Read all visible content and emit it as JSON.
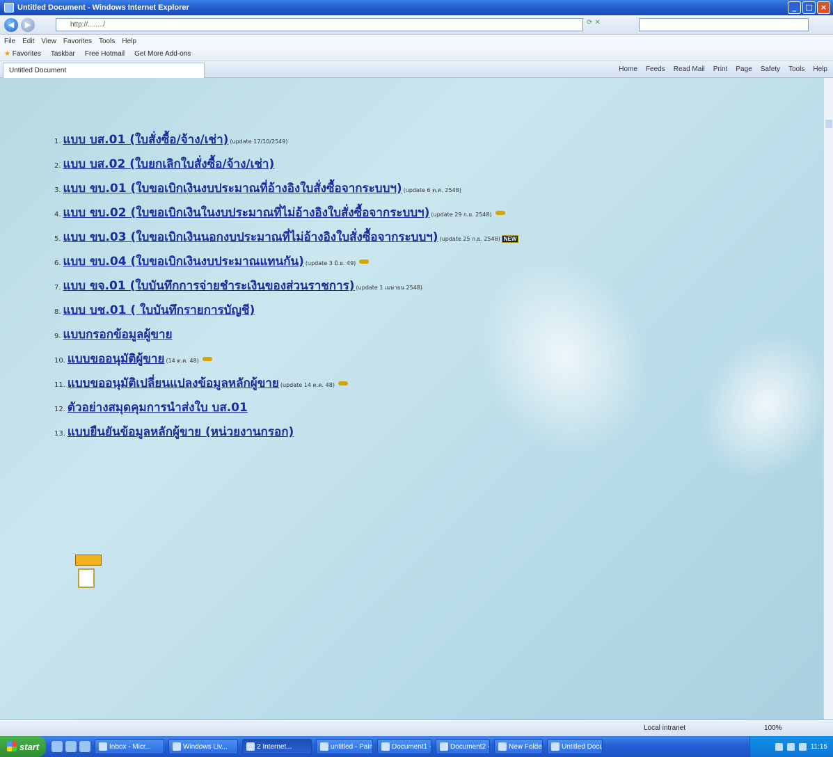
{
  "window": {
    "title": "Untitled Document - Windows Internet Explorer"
  },
  "address": {
    "url": "http://......../"
  },
  "search": {
    "placeholder": ""
  },
  "menu": [
    "File",
    "Edit",
    "View",
    "Favorites",
    "Tools",
    "Help"
  ],
  "favorites": {
    "label": "Favorites",
    "items": [
      "Taskbar",
      "Free Hotmail",
      "Get More Add-ons"
    ]
  },
  "tab": {
    "label": "Untitled Document"
  },
  "command_bar": [
    "Home",
    "Feeds",
    "Read Mail",
    "Print",
    "Page",
    "Safety",
    "Tools",
    "Help"
  ],
  "links": [
    {
      "num": "1.",
      "text": "แบบ บส.01 (ใบสั่งซื้อ/จ้าง/เช่า)",
      "update": "(update 17/10/2549)",
      "new": false
    },
    {
      "num": "2.",
      "text": "แบบ บส.02 (ใบยกเลิกใบสั่งซื้อ/จ้าง/เช่า)",
      "update": "",
      "new": false
    },
    {
      "num": "3.",
      "text": "แบบ ขบ.01 (ใบขอเบิกเงินงบประมาณที่อ้างอิงใบสั่งซื้อจากระบบฯ)",
      "update": "(update 6 ต.ค. 2548)",
      "new": false
    },
    {
      "num": "4.",
      "text": "แบบ ขบ.02 (ใบขอเบิกเงินในงบประมาณที่ไม่อ้างอิงใบสั่งซื้อจากระบบฯ)",
      "update": "(update 29 ก.ย. 2548)",
      "new": true
    },
    {
      "num": "5.",
      "text": "แบบ ขบ.03 (ใบขอเบิกเงินนอกงบประมาณที่ไม่อ้างอิงใบสั่งซื้อจากระบบฯ)",
      "update": "(update 25 ก.ย. 2548)",
      "new": false,
      "newbox": "NEW"
    },
    {
      "num": "6.",
      "text": "แบบ ขบ.04 (ใบขอเบิกเงินงบประมาณแทนกัน)",
      "update": "(update 3 มิ.ย. 49)",
      "new": true
    },
    {
      "num": "7.",
      "text": "แบบ ขจ.01 (ใบบันทึกการจ่ายชำระเงินของส่วนราชการ)",
      "update": "(update 1 เมษายน 2548)",
      "new": false
    },
    {
      "num": "8.",
      "text": "แบบ บช.01 ( ใบบันทึกรายการบัญชี)",
      "update": "",
      "new": false
    },
    {
      "num": "9.",
      "text": "แบบกรอกข้อมูลผู้ขาย",
      "update": "",
      "new": false
    },
    {
      "num": "10.",
      "text": "แบบขออนุมัติผู้ขาย",
      "update": "(14 ต.ค. 48)",
      "new": true
    },
    {
      "num": "11.",
      "text": "แบบขออนุมัติเปลี่ยนแปลงข้อมูลหลักผู้ขาย",
      "update": "(update 14 ต.ค. 48)",
      "new": true
    },
    {
      "num": "12.",
      "text": "ตัวอย่างสมุดคุมการนำส่งใบ บส.01",
      "update": "",
      "new": false
    },
    {
      "num": "13.",
      "text": "แบบยืนยันข้อมูลหลักผู้ขาย (หน่วยงานกรอก)",
      "update": "",
      "new": false
    }
  ],
  "status": {
    "zone": "Local intranet",
    "zoom": "100%"
  },
  "taskbar": {
    "start": "start",
    "buttons": [
      "Inbox - Micr...",
      "Windows Liv...",
      "2 Internet...",
      "untitled - Paint",
      "Document1 - ...",
      "Document2 - ...",
      "New Folder",
      "Untitled Docu..."
    ],
    "clock": "11:15"
  }
}
